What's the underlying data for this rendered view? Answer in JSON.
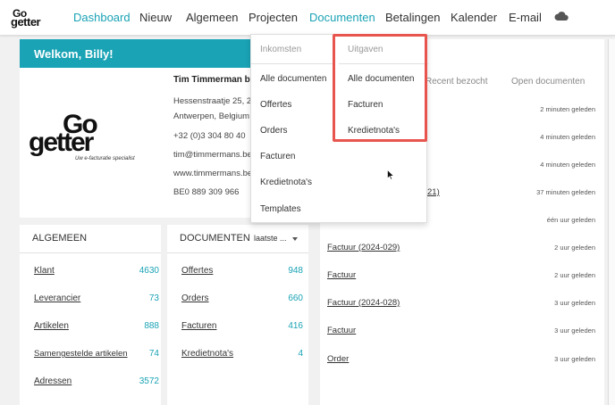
{
  "brand": {
    "logo_top": "Go",
    "logo_bottom": "getter",
    "big_logo_top": "Go",
    "big_logo_bottom": "getter",
    "tagline": "Uw e-facturatie specialist"
  },
  "nav": {
    "items": [
      "Dashboard",
      "Nieuw",
      "Algemeen",
      "Projecten",
      "Documenten",
      "Betalingen",
      "Kalender",
      "E-mail"
    ],
    "active": "Dashboard",
    "open_menu": "Documenten",
    "cloud_icon": "cloud-icon",
    "accent": "#1aa3b5"
  },
  "welcome": {
    "title": "Welkom, Billy!",
    "company": "Tim Timmerman bv",
    "address_line1": "Hessenstraatje 25, 2",
    "address_line2": "Antwerpen, Belgium",
    "phone": "+32 (0)3 304 80 40",
    "email": "tim@timmermans.be",
    "website": "www.timmermans.be",
    "vat": "BE0 889 309 966"
  },
  "recent": {
    "tabs": [
      "Recent bezocht",
      "Open documenten"
    ],
    "rows": [
      {
        "title": "",
        "ago": "2 minuten geleden"
      },
      {
        "title": "",
        "ago": "4 minuten geleden"
      },
      {
        "title": "",
        "ago": "4 minuten geleden"
      },
      {
        "title": "21)",
        "ago": "37 minuten geleden"
      },
      {
        "title": "",
        "ago": "één uur geleden"
      },
      {
        "title": "Factuur (2024-029)",
        "ago": "2 uur geleden"
      },
      {
        "title": "Factuur",
        "ago": "2 uur geleden"
      },
      {
        "title": "Factuur (2024-028)",
        "ago": "3 uur geleden"
      },
      {
        "title": "Factuur",
        "ago": "3 uur geleden"
      },
      {
        "title": "Order",
        "ago": "3 uur geleden"
      }
    ]
  },
  "algemeen": {
    "title": "ALGEMEEN",
    "rows": [
      {
        "label": "Klant",
        "count": "4630"
      },
      {
        "label": "Leverancier",
        "count": "73"
      },
      {
        "label": "Artikelen",
        "count": "888"
      },
      {
        "label": "Samengestelde artikelen",
        "count": "74"
      },
      {
        "label": "Adressen",
        "count": "3572"
      }
    ]
  },
  "documenten": {
    "title": "DOCUMENTEN",
    "period": "laatste ...",
    "rows": [
      {
        "label": "Offertes",
        "count": "948"
      },
      {
        "label": "Orders",
        "count": "660"
      },
      {
        "label": "Facturen",
        "count": "416"
      },
      {
        "label": "Kredietnota's",
        "count": "4"
      }
    ]
  },
  "dropdown": {
    "inkomsten": {
      "heading": "Inkomsten",
      "items": [
        "Alle documenten",
        "Offertes",
        "Orders",
        "Facturen",
        "Kredietnota's",
        "Templates"
      ]
    },
    "uitgaven": {
      "heading": "Uitgaven",
      "items": [
        "Alle documenten",
        "Facturen",
        "Kredietnota's"
      ]
    },
    "highlight_color": "#e8554e"
  }
}
